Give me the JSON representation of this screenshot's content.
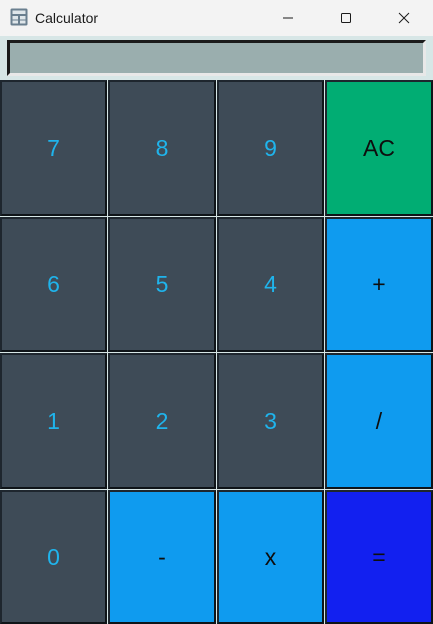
{
  "window": {
    "title": "Calculator",
    "icon": "calculator-icon",
    "controls": {
      "minimize": "minimize-icon",
      "maximize": "maximize-icon",
      "close": "close-icon"
    }
  },
  "display": {
    "value": ""
  },
  "keys": {
    "k7": "7",
    "k8": "8",
    "k9": "9",
    "ac": "AC",
    "k6": "6",
    "k5": "5",
    "k4": "4",
    "plus": "+",
    "k1": "1",
    "k2": "2",
    "k3": "3",
    "divide": "/",
    "k0": "0",
    "minus": "-",
    "multiply": "x",
    "equals": "="
  },
  "colors": {
    "digit_bg": "#3e4b57",
    "digit_text": "#1fb4ec",
    "ac_bg": "#01ad73",
    "operator_bg": "#0f9bef",
    "equals_bg": "#1220f0",
    "display_bg": "#9aaeae"
  }
}
